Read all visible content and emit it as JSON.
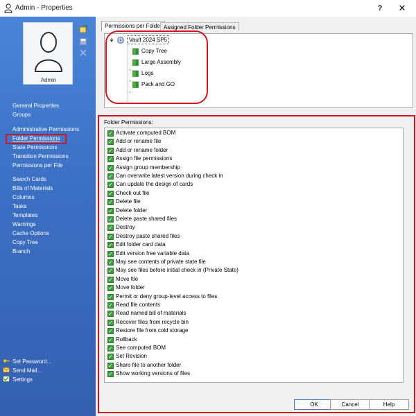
{
  "window": {
    "title": "Admin - Properties",
    "help_label": "?",
    "close_label": "✕"
  },
  "sidebar": {
    "user_name": "Admin",
    "nav_group_1": [
      "General Properties",
      "Groups"
    ],
    "nav_group_2": [
      "Administrative Permissions",
      "Folder Permissions",
      "State Permissions",
      "Transition Permissions",
      "Permissions per File"
    ],
    "nav_group_3": [
      "Search Cards",
      "Bills of Materials",
      "Columns",
      "Tasks",
      "Templates",
      "Warnings",
      "Cache Options",
      "Copy Tree",
      "Branch"
    ],
    "selected_item": "Folder Permissions",
    "bottom_links": [
      "Set Password...",
      "Send Mail...",
      "Settings"
    ]
  },
  "tabs": [
    "Permissions per Folder",
    "Assigned Folder Permissions"
  ],
  "tree": {
    "root": "Vault 2024 SP5",
    "children": [
      "Copy Tree",
      "Large Assembly",
      "Logs",
      "Pack and GO"
    ]
  },
  "permissions": {
    "label": "Folder Permissions:",
    "items": [
      "Activate computed BOM",
      "Add or rename file",
      "Add or rename folder",
      "Assign file permissions",
      "Assign group membership",
      "Can overwrite latest version during check in",
      "Can update the design of cards",
      "Check out file",
      "Delete file",
      "Delete folder",
      "Delete paste shared files",
      "Destroy",
      "Destroy paste shared files",
      "Edit folder card data",
      "Edit version free variable data",
      "May see contents of private state file",
      "May see files before initial check in (Private State)",
      "Move file",
      "Move folder",
      "Permit or deny group-level access to files",
      "Read file contents",
      "Read named bill of materials",
      "Recover files from recycle bin",
      "Restore file from cold storage",
      "Rollback",
      "See computed BOM",
      "Set Revision",
      "Share file to another folder",
      "Show working versions of files"
    ],
    "checked": true
  },
  "footer": {
    "ok": "OK",
    "cancel": "Cancel",
    "help": "Help"
  },
  "colors": {
    "sidebar": "#3b6fc3",
    "highlight": "#d4141c",
    "check": "#3c9a3c"
  }
}
